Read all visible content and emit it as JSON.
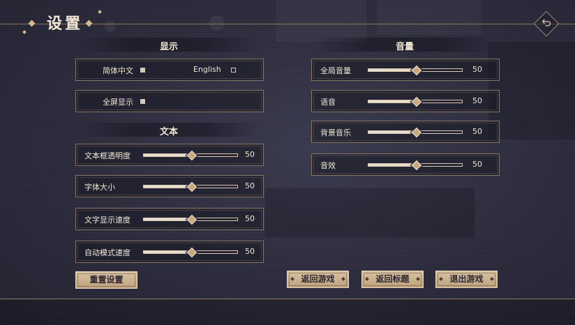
{
  "header": {
    "title": "设置"
  },
  "display": {
    "section_title": "显示",
    "languages": [
      {
        "label": "简体中文",
        "selected": true
      },
      {
        "label": "English",
        "selected": false
      }
    ],
    "fullscreen": {
      "label": "全屏显示",
      "checked": true
    }
  },
  "text": {
    "section_title": "文本",
    "sliders": [
      {
        "label": "文本框透明度",
        "value": "50",
        "level": 0.5
      },
      {
        "label": "字体大小",
        "value": "50",
        "level": 0.5
      },
      {
        "label": "文字显示速度",
        "value": "50",
        "level": 0.5
      },
      {
        "label": "自动模式速度",
        "value": "50",
        "level": 0.5
      }
    ]
  },
  "volume": {
    "section_title": "音量",
    "sliders": [
      {
        "label": "全局音量",
        "value": "50",
        "level": 0.5
      },
      {
        "label": "语音",
        "value": "50",
        "level": 0.5
      },
      {
        "label": "背景音乐",
        "value": "50",
        "level": 0.5
      },
      {
        "label": "音效",
        "value": "50",
        "level": 0.5
      }
    ]
  },
  "buttons": {
    "reset": "重置设置",
    "return_game": "返回游戏",
    "return_title": "返回标题",
    "exit_game": "退出游戏"
  },
  "colors": {
    "accent": "#c8a87e",
    "text": "#f1e7d6",
    "border": "#8a7866",
    "background": "#2b2b3c"
  },
  "icons": {
    "back": "return-arrow-icon"
  }
}
